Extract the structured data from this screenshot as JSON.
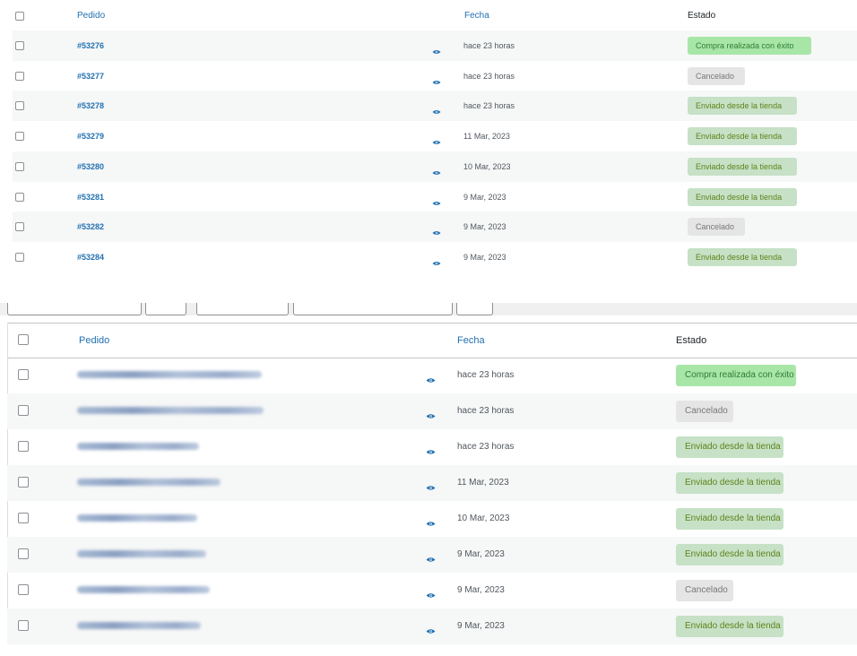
{
  "header": {
    "pedido": "Pedido",
    "fecha": "Fecha",
    "estado": "Estado"
  },
  "orders": [
    {
      "id": "#53276",
      "date": "hace 23 horas",
      "status": "Compra realizada con éxito"
    },
    {
      "id": "#53277",
      "date": "hace 23 horas",
      "status": "Cancelado"
    },
    {
      "id": "#53278",
      "date": "hace 23 horas",
      "status": "Enviado desde la tienda"
    },
    {
      "id": "#53279",
      "date": "11 Mar, 2023",
      "status": "Enviado desde la tienda"
    },
    {
      "id": "#53280",
      "date": "10 Mar, 2023",
      "status": "Enviado desde la tienda"
    },
    {
      "id": "#53281",
      "date": "9 Mar, 2023",
      "status": "Enviado desde la tienda"
    },
    {
      "id": "#53282",
      "date": "9 Mar, 2023",
      "status": "Cancelado"
    },
    {
      "id": "#53284",
      "date": "9 Mar, 2023",
      "status": "Enviado desde la tienda"
    }
  ],
  "orders_blurred": [
    {
      "date": "hace 23 horas",
      "status": "Compra realizada con éxito"
    },
    {
      "date": "hace 23 horas",
      "status": "Cancelado"
    },
    {
      "date": "hace 23 horas",
      "status": "Enviado desde la tienda"
    },
    {
      "date": "11 Mar, 2023",
      "status": "Enviado desde la tienda"
    },
    {
      "date": "10 Mar, 2023",
      "status": "Enviado desde la tienda"
    },
    {
      "date": "9 Mar, 2023",
      "status": "Enviado desde la tienda"
    },
    {
      "date": "9 Mar, 2023",
      "status": "Cancelado"
    },
    {
      "date": "9 Mar, 2023",
      "status": "Enviado desde la tienda"
    }
  ],
  "colors": {
    "link": "#2271b1",
    "shipped_bg": "#c6e1c6",
    "success_bg": "#a8e6a8",
    "cancelled_bg": "#e5e5e5"
  }
}
